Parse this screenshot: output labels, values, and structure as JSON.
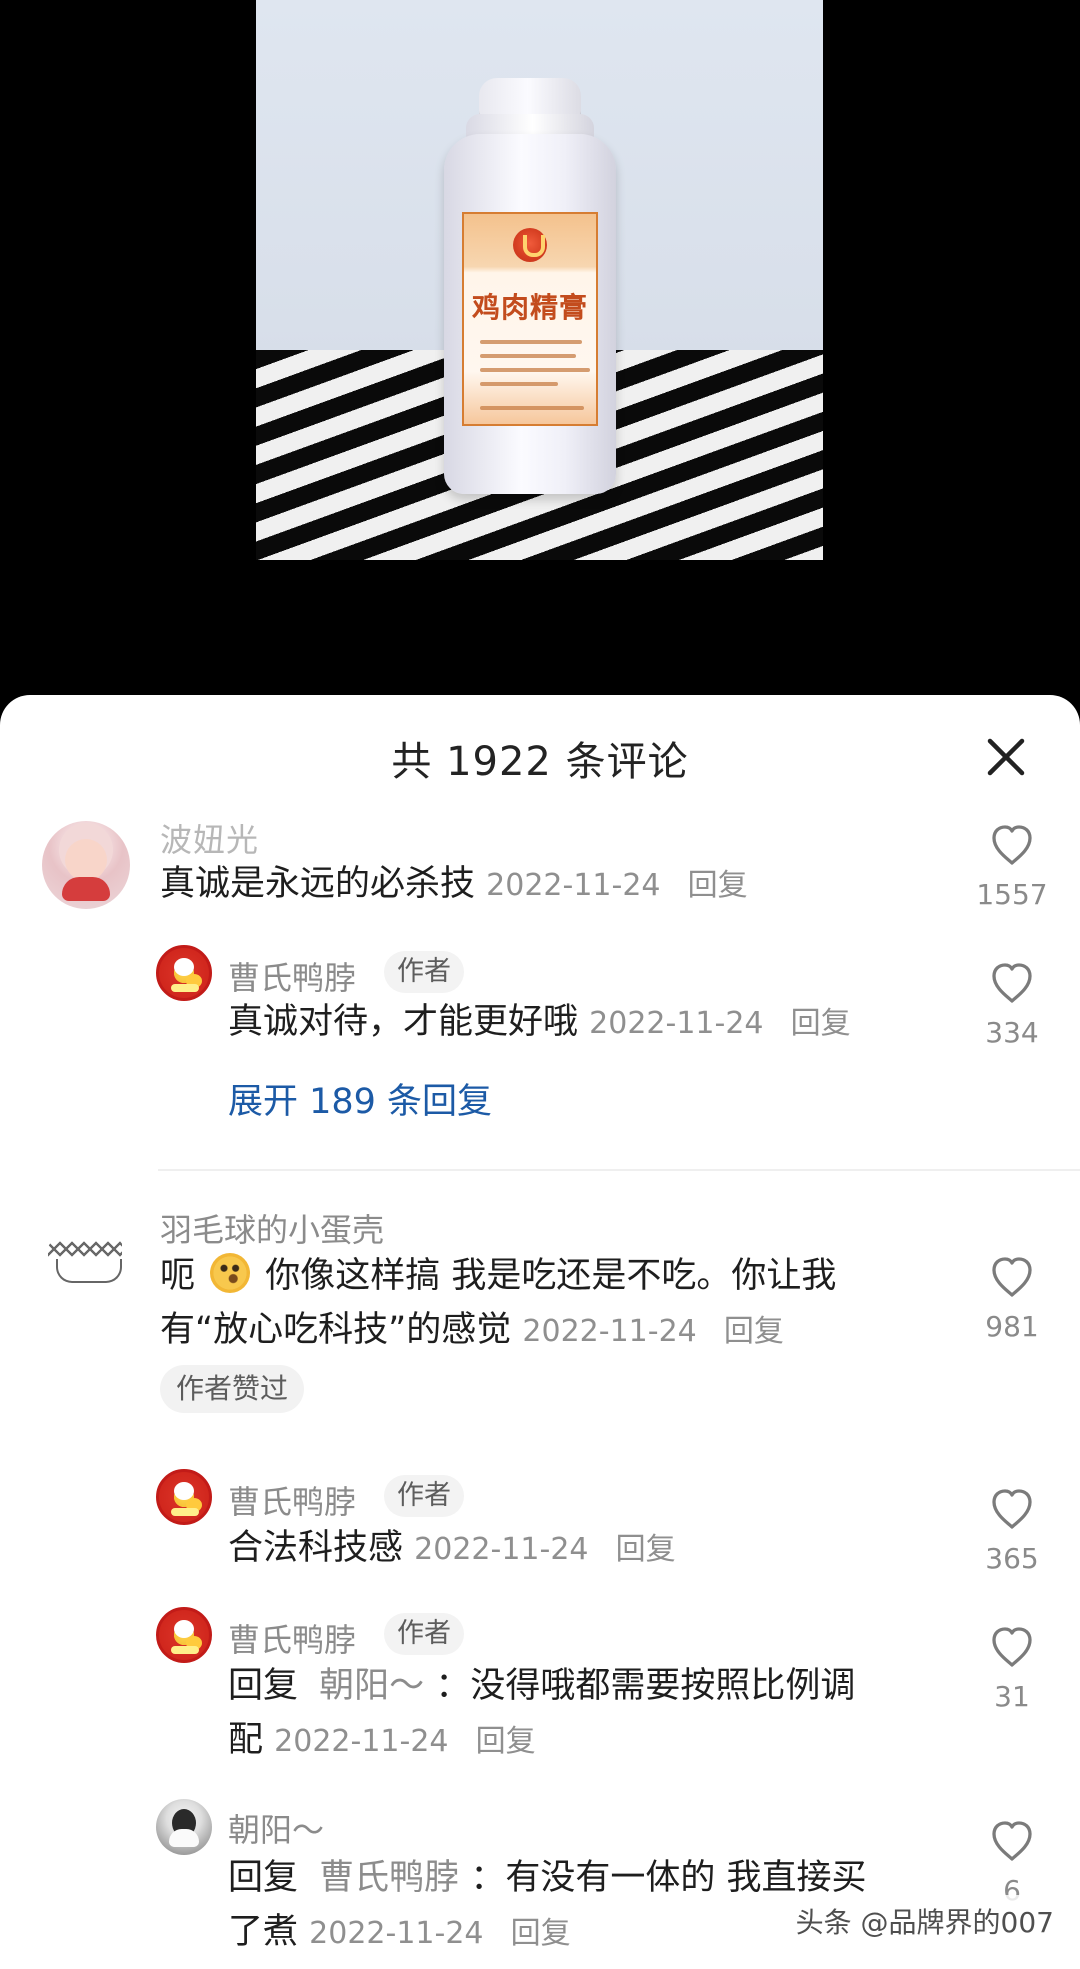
{
  "header": {
    "title": "共 1922 条评论",
    "close_icon": "close-icon"
  },
  "media": {
    "product_label": "鸡肉精膏"
  },
  "comments": [
    {
      "username": "波妞光",
      "text": "真诚是永远的必杀技",
      "date": "2022-11-24",
      "reply_label": "回复",
      "likes": "1557",
      "replies": [
        {
          "username": "曹氏鸭脖",
          "badge": "作者",
          "text": "真诚对待，才能更好哦",
          "date": "2022-11-24",
          "reply_label": "回复",
          "likes": "334"
        }
      ],
      "expand_text": "展开 189 条回复"
    },
    {
      "username": "羽毛球的小蛋壳",
      "text_line_1_before_emoji": "呃",
      "emoji_name": "thinking-face-icon",
      "text_line_1_after_emoji": "你像这样搞 我是吃还是不吃。你让我",
      "text_line_2": "有“放心吃科技”的感觉",
      "date": "2022-11-24",
      "reply_label": "回复",
      "liked_badge": "作者赞过",
      "likes": "981",
      "replies": [
        {
          "username": "曹氏鸭脖",
          "badge": "作者",
          "text": "合法科技感",
          "date": "2022-11-24",
          "reply_label": "回复",
          "likes": "365"
        },
        {
          "username": "曹氏鸭脖",
          "badge": "作者",
          "text_prefix": "回复",
          "reply_to": "朝阳～",
          "text_line_1": "：没得哦都需要按照比例调",
          "text_line_2": "配",
          "date": "2022-11-24",
          "reply_label": "回复",
          "likes": "31"
        },
        {
          "username": "朝阳～",
          "text_prefix": "回复",
          "reply_to": "曹氏鸭脖",
          "text_line_1": "：有没有一体的 我直接买",
          "text_line_2": "了煮",
          "date": "2022-11-24",
          "reply_label": "回复",
          "likes": "6"
        }
      ]
    }
  ],
  "watermark": "头条 @品牌界的007",
  "colors": {
    "link_blue": "#1c5aa6",
    "muted_gray": "#8f8f8f",
    "badge_bg": "#f2f2f2",
    "sheet_bg": "#ffffff",
    "top_bg": "#000000"
  }
}
